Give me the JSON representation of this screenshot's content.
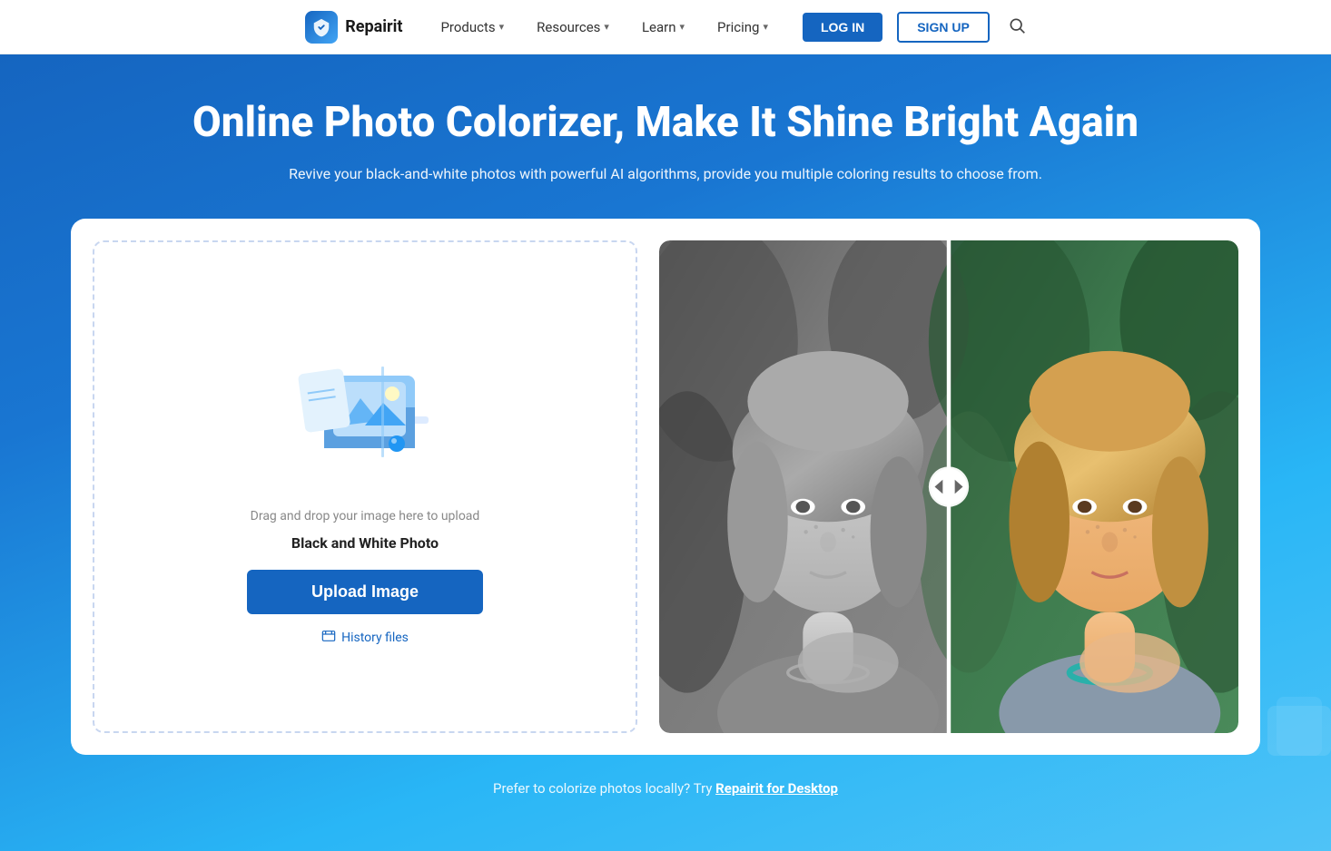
{
  "nav": {
    "logo_text": "Repairit",
    "products_label": "Products",
    "resources_label": "Resources",
    "learn_label": "Learn",
    "pricing_label": "Pricing",
    "login_label": "LOG IN",
    "signup_label": "SIGN UP"
  },
  "hero": {
    "title": "Online Photo Colorizer, Make It Shine Bright Again",
    "subtitle": "Revive your black-and-white photos with powerful AI algorithms, provide you multiple coloring results to choose from.",
    "upload_drag_text": "Drag and drop your image here to upload",
    "upload_type_text": "Black and White Photo",
    "upload_btn_label": "Upload Image",
    "history_label": "History files",
    "footer_text": "Prefer to colorize photos locally? Try ",
    "footer_link_text": "Repairit for Desktop"
  }
}
